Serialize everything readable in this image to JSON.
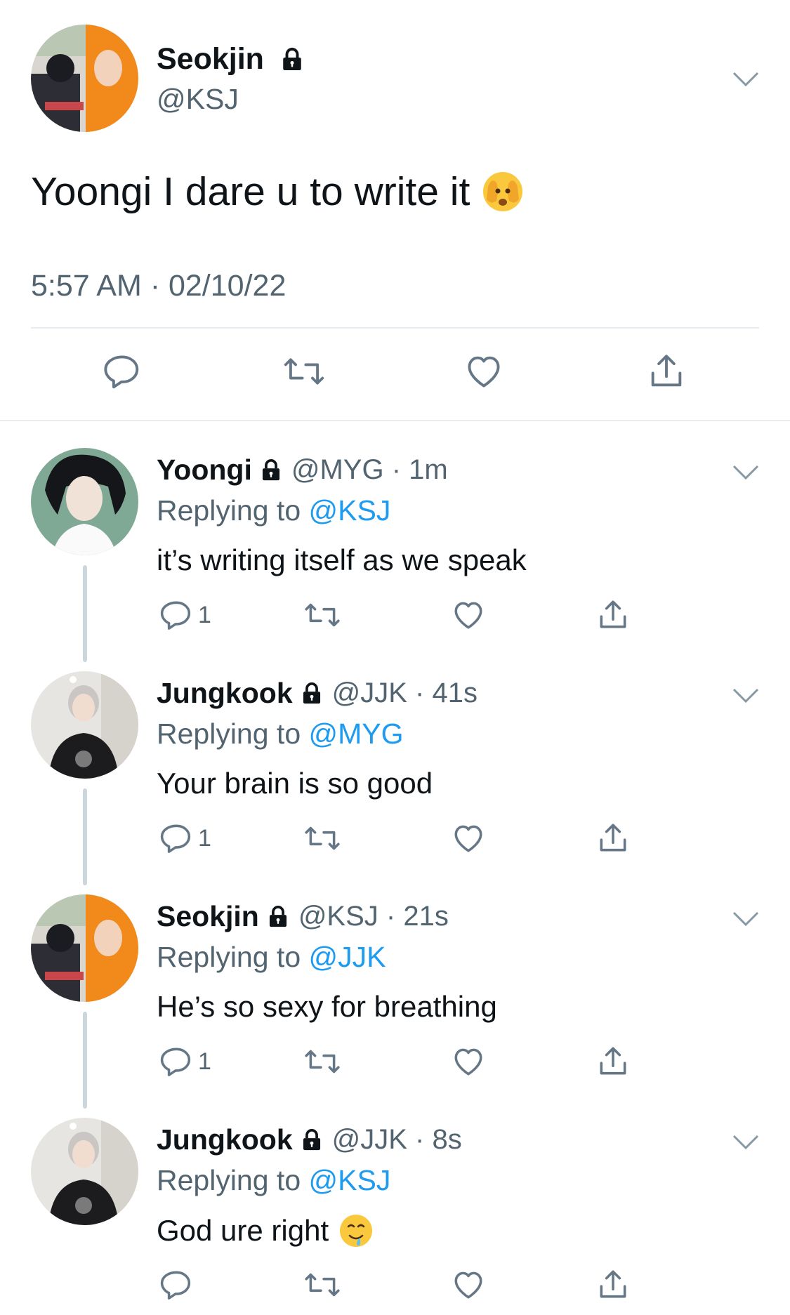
{
  "main_tweet": {
    "name": "Seokjin",
    "handle": "@KSJ",
    "text": "Yoongi I dare u to write it",
    "text_emoji": "peeking-face-emoji",
    "time": "5:57 AM · 02/10/22"
  },
  "replies": [
    {
      "name": "Yoongi",
      "handle_time": "@MYG · 1m",
      "replying_label": "Replying to",
      "replying_to": "@KSJ",
      "text": "it’s writing itself as we speak",
      "reply_count": "1"
    },
    {
      "name": "Jungkook",
      "handle_time": "@JJK · 41s",
      "replying_label": "Replying to",
      "replying_to": "@MYG",
      "text": "Your brain is so good",
      "reply_count": "1"
    },
    {
      "name": "Seokjin",
      "handle_time": "@KSJ · 21s",
      "replying_label": "Replying to",
      "replying_to": "@JJK",
      "text": "He’s so sexy for breathing",
      "reply_count": "1"
    },
    {
      "name": "Jungkook",
      "handle_time": "@JJK · 8s",
      "replying_label": "Replying to",
      "replying_to": "@KSJ",
      "text": "God ure right",
      "text_emoji": "drooling-face-emoji",
      "reply_count": ""
    }
  ],
  "colors": {
    "text": "#0f1419",
    "muted": "#536471",
    "link": "#1d9bf0",
    "divider": "#e6ecf0",
    "thread": "#ccd6dd"
  }
}
